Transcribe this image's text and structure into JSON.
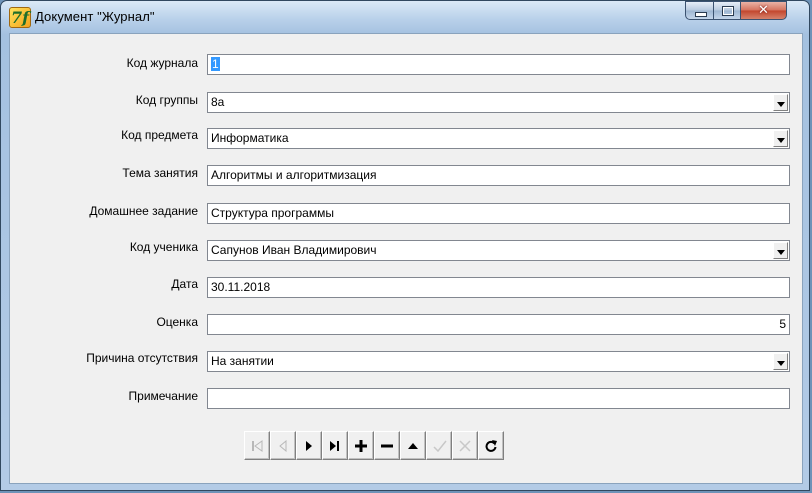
{
  "window": {
    "title": "Документ \"Журнал\"",
    "icon": "app-icon",
    "icon_glyph": "7f",
    "controls": {
      "close_glyph": "✕"
    }
  },
  "form": {
    "fields": [
      {
        "label": "Код журнала",
        "value": "1",
        "type": "text",
        "selected": true
      },
      {
        "label": "Код группы",
        "value": "8а",
        "type": "combo"
      },
      {
        "label": "Код предмета",
        "value": "Информатика",
        "type": "combo"
      },
      {
        "label": "Тема занятия",
        "value": "Алгоритмы и алгоритмизация",
        "type": "text"
      },
      {
        "label": "Домашнее задание",
        "value": "Структура программы",
        "type": "text"
      },
      {
        "label": "Код ученика",
        "value": "Сапунов Иван Владимирович",
        "type": "combo"
      },
      {
        "label": "Дата",
        "value": "30.11.2018",
        "type": "text"
      },
      {
        "label": "Оценка",
        "value": "5",
        "type": "text",
        "align": "right"
      },
      {
        "label": "Причина отсутствия",
        "value": "На занятии",
        "type": "combo"
      },
      {
        "label": "Примечание",
        "value": "",
        "type": "text"
      }
    ]
  },
  "navigator": {
    "buttons": [
      {
        "name": "first-record-icon",
        "enabled": false
      },
      {
        "name": "prior-record-icon",
        "enabled": false
      },
      {
        "name": "next-record-icon",
        "enabled": true
      },
      {
        "name": "last-record-icon",
        "enabled": true
      },
      {
        "name": "insert-record-icon",
        "enabled": true
      },
      {
        "name": "delete-record-icon",
        "enabled": true
      },
      {
        "name": "edit-record-icon",
        "enabled": true
      },
      {
        "name": "post-record-icon",
        "enabled": false
      },
      {
        "name": "cancel-record-icon",
        "enabled": false
      },
      {
        "name": "refresh-record-icon",
        "enabled": true
      }
    ]
  }
}
